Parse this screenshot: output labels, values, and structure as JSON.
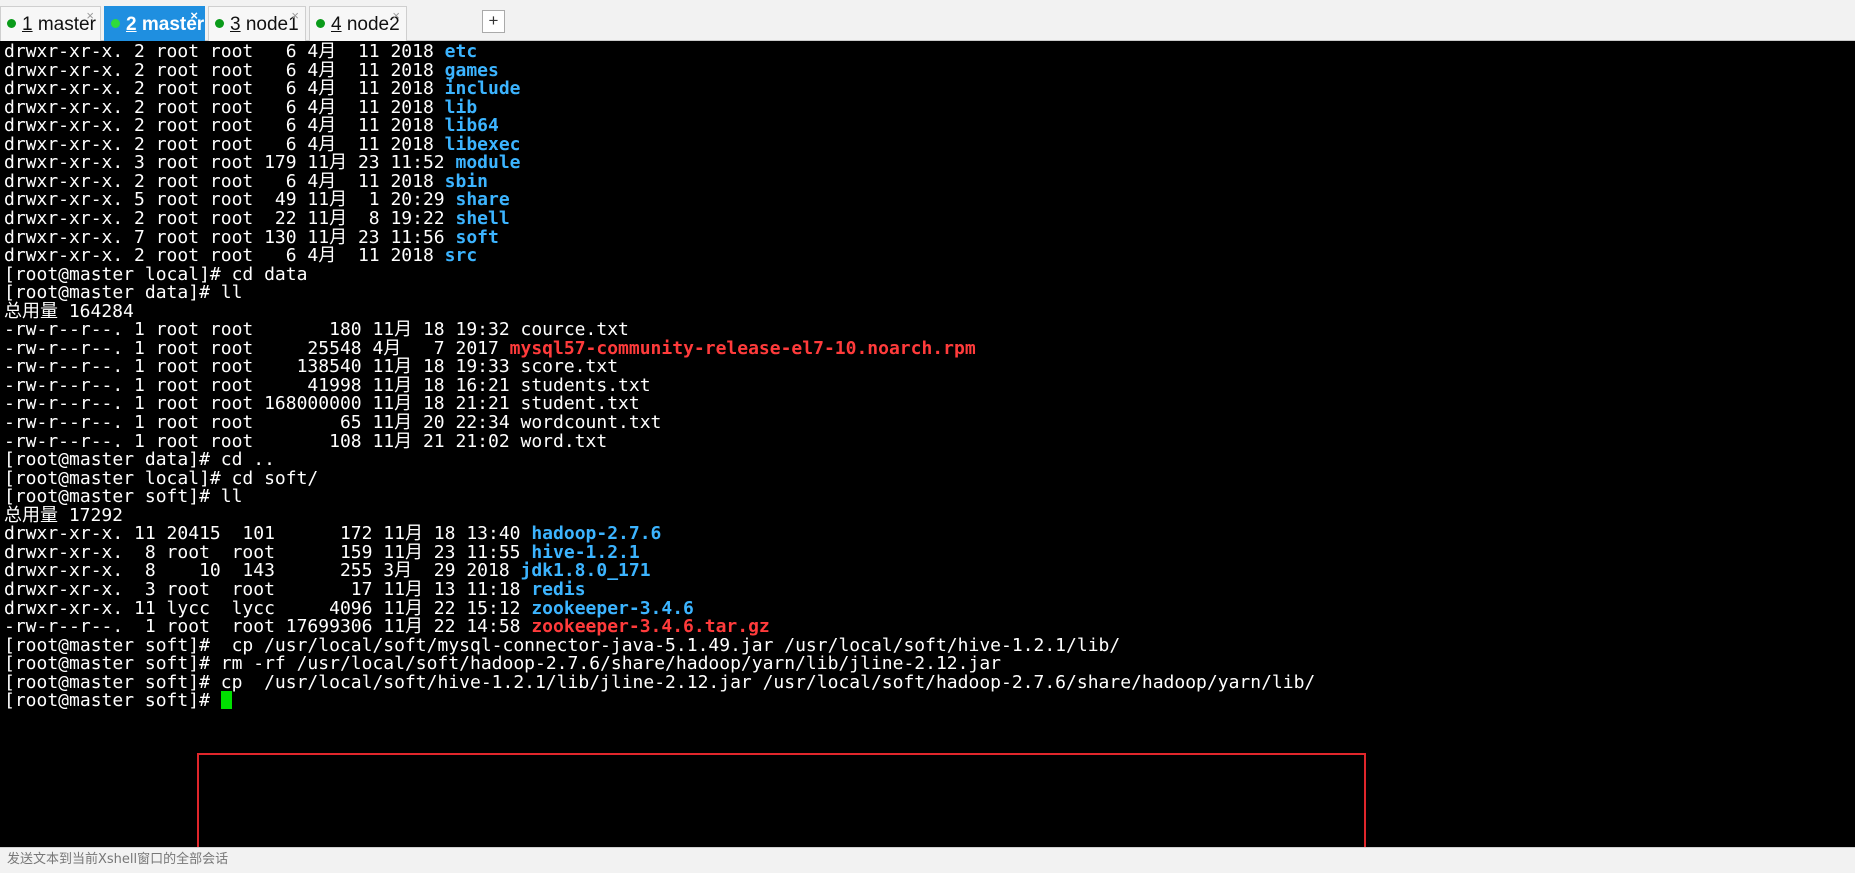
{
  "tabs": [
    {
      "num": "1",
      "label": "master",
      "active": false
    },
    {
      "num": "2",
      "label": "master",
      "active": true
    },
    {
      "num": "3",
      "label": "node1",
      "active": false
    },
    {
      "num": "4",
      "label": "node2",
      "active": false
    }
  ],
  "new_tab_label": "+",
  "tab_close_glyph": "×",
  "terminal": {
    "lines": [
      {
        "prefix": "drwxr-xr-x. 2 root root   6 4月  11 2018 ",
        "name": "etc",
        "kind": "dir"
      },
      {
        "prefix": "drwxr-xr-x. 2 root root   6 4月  11 2018 ",
        "name": "games",
        "kind": "dir"
      },
      {
        "prefix": "drwxr-xr-x. 2 root root   6 4月  11 2018 ",
        "name": "include",
        "kind": "dir"
      },
      {
        "prefix": "drwxr-xr-x. 2 root root   6 4月  11 2018 ",
        "name": "lib",
        "kind": "dir"
      },
      {
        "prefix": "drwxr-xr-x. 2 root root   6 4月  11 2018 ",
        "name": "lib64",
        "kind": "dir"
      },
      {
        "prefix": "drwxr-xr-x. 2 root root   6 4月  11 2018 ",
        "name": "libexec",
        "kind": "dir"
      },
      {
        "prefix": "drwxr-xr-x. 3 root root 179 11月 23 11:52 ",
        "name": "module",
        "kind": "dir"
      },
      {
        "prefix": "drwxr-xr-x. 2 root root   6 4月  11 2018 ",
        "name": "sbin",
        "kind": "dir"
      },
      {
        "prefix": "drwxr-xr-x. 5 root root  49 11月  1 20:29 ",
        "name": "share",
        "kind": "dir"
      },
      {
        "prefix": "drwxr-xr-x. 2 root root  22 11月  8 19:22 ",
        "name": "shell",
        "kind": "dir"
      },
      {
        "prefix": "drwxr-xr-x. 7 root root 130 11月 23 11:56 ",
        "name": "soft",
        "kind": "dir"
      },
      {
        "prefix": "drwxr-xr-x. 2 root root   6 4月  11 2018 ",
        "name": "src",
        "kind": "dir"
      },
      {
        "prefix": "[root@master local]# cd data",
        "name": "",
        "kind": "text"
      },
      {
        "prefix": "[root@master data]# ll",
        "name": "",
        "kind": "text"
      },
      {
        "prefix": "总用量 164284",
        "name": "",
        "kind": "text"
      },
      {
        "prefix": "-rw-r--r--. 1 root root       180 11月 18 19:32 ",
        "name": "cource.txt",
        "kind": "file"
      },
      {
        "prefix": "-rw-r--r--. 1 root root     25548 4月   7 2017 ",
        "name": "mysql57-community-release-el7-10.noarch.rpm",
        "kind": "archive"
      },
      {
        "prefix": "-rw-r--r--. 1 root root    138540 11月 18 19:33 ",
        "name": "score.txt",
        "kind": "file"
      },
      {
        "prefix": "-rw-r--r--. 1 root root     41998 11月 18 16:21 ",
        "name": "students.txt",
        "kind": "file"
      },
      {
        "prefix": "-rw-r--r--. 1 root root 168000000 11月 18 21:21 ",
        "name": "student.txt",
        "kind": "file"
      },
      {
        "prefix": "-rw-r--r--. 1 root root        65 11月 20 22:34 ",
        "name": "wordcount.txt",
        "kind": "file"
      },
      {
        "prefix": "-rw-r--r--. 1 root root       108 11月 21 21:02 ",
        "name": "word.txt",
        "kind": "file"
      },
      {
        "prefix": "[root@master data]# cd ..",
        "name": "",
        "kind": "text"
      },
      {
        "prefix": "[root@master local]# cd soft/",
        "name": "",
        "kind": "text"
      },
      {
        "prefix": "[root@master soft]# ll",
        "name": "",
        "kind": "text"
      },
      {
        "prefix": "总用量 17292",
        "name": "",
        "kind": "text"
      },
      {
        "prefix": "drwxr-xr-x. 11 20415  101      172 11月 18 13:40 ",
        "name": "hadoop-2.7.6",
        "kind": "dir"
      },
      {
        "prefix": "drwxr-xr-x.  8 root  root      159 11月 23 11:55 ",
        "name": "hive-1.2.1",
        "kind": "dir"
      },
      {
        "prefix": "drwxr-xr-x.  8    10  143      255 3月  29 2018 ",
        "name": "jdk1.8.0_171",
        "kind": "dir"
      },
      {
        "prefix": "drwxr-xr-x.  3 root  root       17 11月 13 11:18 ",
        "name": "redis",
        "kind": "dir"
      },
      {
        "prefix": "drwxr-xr-x. 11 lycc  lycc     4096 11月 22 15:12 ",
        "name": "zookeeper-3.4.6",
        "kind": "dir"
      },
      {
        "prefix": "-rw-r--r--.  1 root  root 17699306 11月 22 14:58 ",
        "name": "zookeeper-3.4.6.tar.gz",
        "kind": "archive"
      },
      {
        "prefix": "[root@master soft]#  cp /usr/local/soft/mysql-connector-java-5.1.49.jar /usr/local/soft/hive-1.2.1/lib/",
        "name": "",
        "kind": "text"
      },
      {
        "prefix": "[root@master soft]# rm -rf /usr/local/soft/hadoop-2.7.6/share/hadoop/yarn/lib/jline-2.12.jar",
        "name": "",
        "kind": "text"
      },
      {
        "prefix": "[root@master soft]# cp  /usr/local/soft/hive-1.2.1/lib/jline-2.12.jar /usr/local/soft/hadoop-2.7.6/share/hadoop/yarn/lib/",
        "name": "",
        "kind": "text"
      }
    ],
    "prompt": "[root@master soft]# "
  },
  "status_bar": {
    "text": "发送文本到当前Xshell窗口的全部会话"
  },
  "colors": {
    "directory": "#3cb4ff",
    "archive": "#ff3b3b",
    "cursor": "#00e000",
    "active_tab": "#1f8fe0",
    "highlight_box": "#e0262b"
  }
}
